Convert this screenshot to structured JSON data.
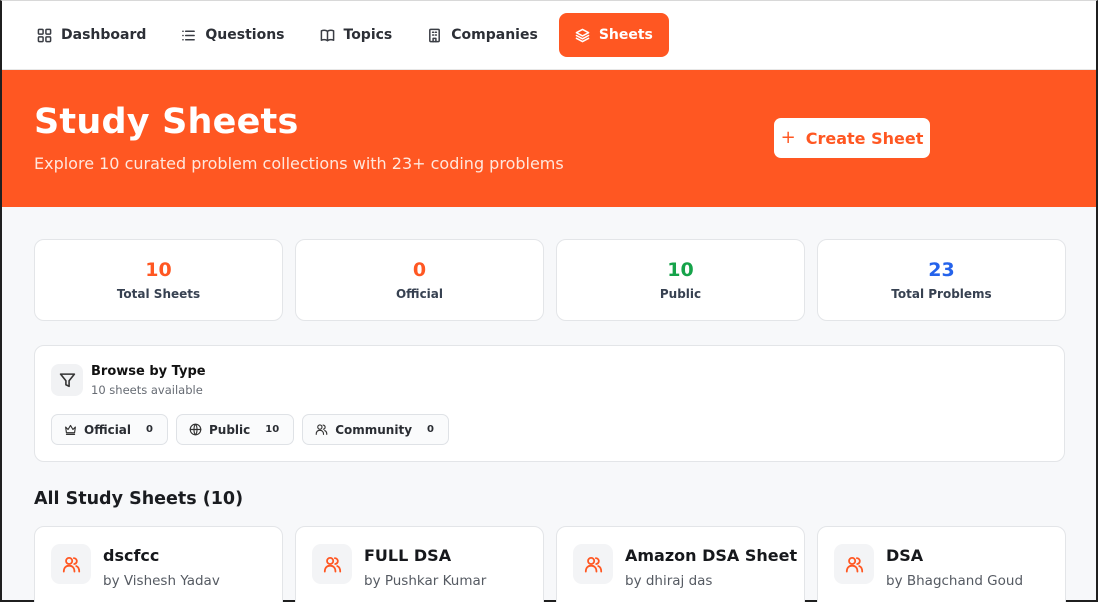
{
  "nav": {
    "items": [
      {
        "label": "Dashboard",
        "icon": "grid-icon"
      },
      {
        "label": "Questions",
        "icon": "list-icon"
      },
      {
        "label": "Topics",
        "icon": "book-icon"
      },
      {
        "label": "Companies",
        "icon": "building-icon"
      },
      {
        "label": "Sheets",
        "icon": "layers-icon",
        "active": true
      }
    ]
  },
  "hero": {
    "title": "Study Sheets",
    "subtitle": "Explore 10 curated problem collections with 23+ coding problems",
    "create_button": "Create Sheet",
    "create_icon": "+"
  },
  "stats": [
    {
      "value": "10",
      "label": "Total Sheets",
      "color": "#ff5722"
    },
    {
      "value": "0",
      "label": "Official",
      "color": "#ff5722"
    },
    {
      "value": "10",
      "label": "Public",
      "color": "#16a34a"
    },
    {
      "value": "23",
      "label": "Total Problems",
      "color": "#2563eb"
    }
  ],
  "browse": {
    "title": "Browse by Type",
    "subtitle": "10 sheets available",
    "chips": [
      {
        "label": "Official",
        "count": "0",
        "icon": "crown-icon"
      },
      {
        "label": "Public",
        "count": "10",
        "icon": "globe-icon"
      },
      {
        "label": "Community",
        "count": "0",
        "icon": "users-icon"
      }
    ]
  },
  "section": {
    "title": "All Study Sheets (10)"
  },
  "sheets": [
    {
      "title": "dscfcc",
      "author": "by Vishesh Yadav",
      "icon": "users-icon"
    },
    {
      "title": "FULL DSA",
      "author": "by Pushkar Kumar",
      "icon": "users-icon"
    },
    {
      "title": "Amazon DSA Sheet",
      "author": "by dhiraj das",
      "icon": "users-icon"
    },
    {
      "title": "DSA",
      "author": "by Bhagchand Goud",
      "icon": "users-icon"
    }
  ],
  "colors": {
    "accent": "#ff5722",
    "public_green": "#16a34a",
    "problems_blue": "#2563eb"
  }
}
